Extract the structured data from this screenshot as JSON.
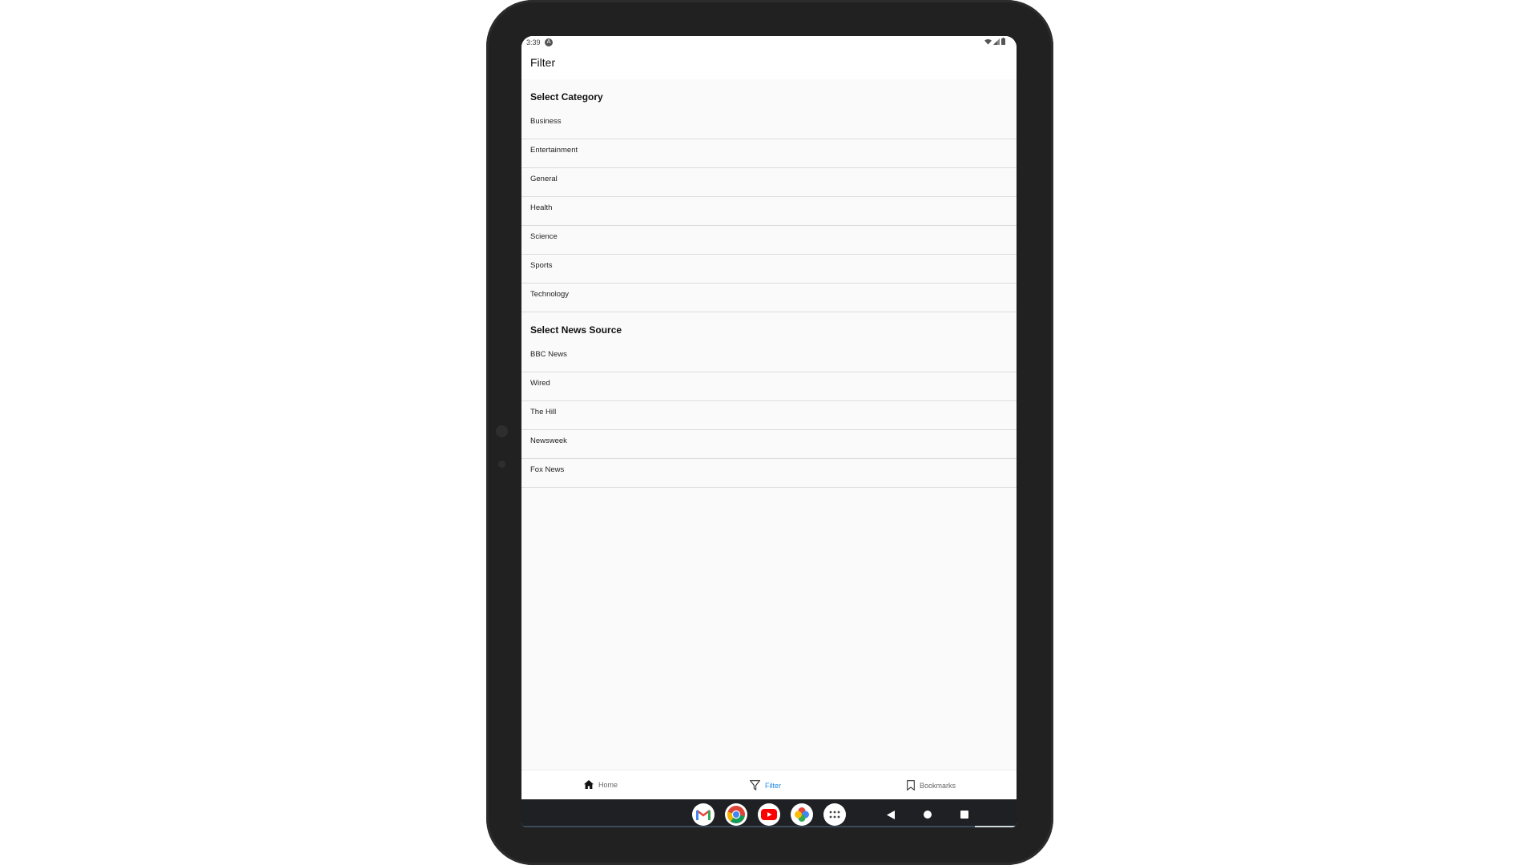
{
  "status_bar": {
    "time": "3:39",
    "notification_icon": "android-notification-icon",
    "icons": [
      "wifi-icon",
      "signal-icon",
      "battery-icon"
    ]
  },
  "app_bar": {
    "title": "Filter"
  },
  "categories": {
    "heading": "Select Category",
    "items": [
      "Business",
      "Entertainment",
      "General",
      "Health",
      "Science",
      "Sports",
      "Technology"
    ]
  },
  "sources": {
    "heading": "Select News Source",
    "items": [
      "BBC News",
      "Wired",
      "The Hill",
      "Newsweek",
      "Fox News"
    ]
  },
  "bottom_nav": {
    "items": [
      {
        "label": "Home",
        "icon": "home-icon",
        "active": false
      },
      {
        "label": "Filter",
        "icon": "filter-icon",
        "active": true
      },
      {
        "label": "Bookmarks",
        "icon": "bookmark-icon",
        "active": false
      }
    ]
  },
  "dock": {
    "apps": [
      "gmail-icon",
      "chrome-icon",
      "youtube-icon",
      "photos-icon",
      "app-drawer-icon"
    ]
  },
  "system_nav": [
    "back-button",
    "home-button",
    "recents-button"
  ],
  "colors": {
    "accent": "#1e88e5",
    "device_frame": "#212121",
    "screen_bg": "#fafafa",
    "navbar": "#1f2023"
  }
}
